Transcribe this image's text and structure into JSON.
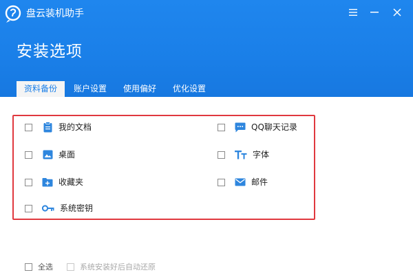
{
  "app": {
    "title": "盘云装机助手",
    "accent_color": "#1a7fe8",
    "highlight_color": "#e0383e"
  },
  "window_controls": [
    {
      "name": "menu-icon"
    },
    {
      "name": "minimize-icon"
    },
    {
      "name": "close-icon"
    }
  ],
  "page": {
    "title": "安装选项"
  },
  "tabs": [
    {
      "label": "资料备份",
      "active": true
    },
    {
      "label": "账户设置",
      "active": false
    },
    {
      "label": "使用偏好",
      "active": false
    },
    {
      "label": "优化设置",
      "active": false
    }
  ],
  "options": {
    "left": [
      {
        "label": "我的文档",
        "icon": "clipboard-icon",
        "checked": false
      },
      {
        "label": "桌面",
        "icon": "image-icon",
        "checked": false
      },
      {
        "label": "收藏夹",
        "icon": "folder-plus-icon",
        "checked": false
      },
      {
        "label": "系统密钥",
        "icon": "key-icon",
        "checked": false
      }
    ],
    "right": [
      {
        "label": "QQ聊天记录",
        "icon": "chat-icon",
        "checked": false
      },
      {
        "label": "字体",
        "icon": "font-icon",
        "checked": false
      },
      {
        "label": "邮件",
        "icon": "mail-icon",
        "checked": false
      }
    ]
  },
  "footer": {
    "select_all_label": "全选",
    "auto_restore_label": "系统安装好后自动还原"
  }
}
